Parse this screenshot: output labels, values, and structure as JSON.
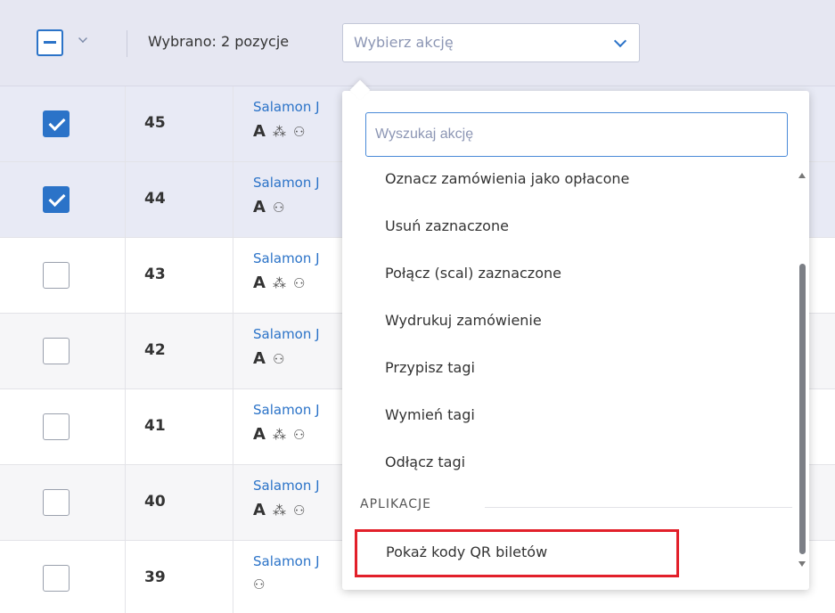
{
  "toolbar": {
    "selected_text": "Wybrano: 2 pozycje",
    "action_placeholder": "Wybierz akcję"
  },
  "rows": [
    {
      "number": "45",
      "customer": "Salamon J",
      "icons": [
        "A",
        "invoice-icon",
        "user-x-icon"
      ],
      "selected": true
    },
    {
      "number": "44",
      "customer": "Salamon J",
      "icons": [
        "A",
        "user-x-icon"
      ],
      "selected": true
    },
    {
      "number": "43",
      "customer": "Salamon J",
      "icons": [
        "A",
        "invoice-icon",
        "user-x-icon"
      ],
      "selected": false
    },
    {
      "number": "42",
      "customer": "Salamon J",
      "icons": [
        "A",
        "user-x-icon"
      ],
      "selected": false
    },
    {
      "number": "41",
      "customer": "Salamon J",
      "icons": [
        "A",
        "invoice-icon",
        "user-x-icon"
      ],
      "selected": false
    },
    {
      "number": "40",
      "customer": "Salamon J",
      "icons": [
        "A",
        "invoice-icon",
        "user-x-icon"
      ],
      "selected": false
    },
    {
      "number": "39",
      "customer": "Salamon J",
      "icons": [
        "user-x-icon"
      ],
      "selected": false
    }
  ],
  "dropdown": {
    "search_placeholder": "Wyszukaj akcję",
    "items": [
      "Oznacz zamówienia jako opłacone",
      "Usuń zaznaczone",
      "Połącz (scal) zaznaczone",
      "Wydrukuj zamówienie",
      "Przypisz tagi",
      "Wymień tagi",
      "Odłącz tagi"
    ],
    "group_label": "APLIKACJE",
    "app_item": "Pokaż kody QR biletów"
  },
  "colors": {
    "accent": "#2b73c8",
    "highlight_border": "#e2202a",
    "toolbar_bg": "#e6e7f2",
    "selected_row_bg": "#e8eaf5"
  }
}
